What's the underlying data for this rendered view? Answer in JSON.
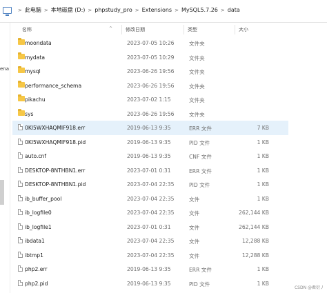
{
  "breadcrumb": [
    "此电脑",
    "本地磁盘 (D:)",
    "phpstudy_pro",
    "Extensions",
    "MySQL5.7.26",
    "data"
  ],
  "sidebar": {
    "partial_label": "ena"
  },
  "columns": {
    "name": "名称",
    "date": "修改日期",
    "type": "类型",
    "size": "大小"
  },
  "files": [
    {
      "name": "moondata",
      "date": "2023-07-05 10:26",
      "type": "文件夹",
      "size": "",
      "kind": "folder"
    },
    {
      "name": "mydata",
      "date": "2023-07-05 10:29",
      "type": "文件夹",
      "size": "",
      "kind": "folder"
    },
    {
      "name": "mysql",
      "date": "2023-06-26 19:56",
      "type": "文件夹",
      "size": "",
      "kind": "folder"
    },
    {
      "name": "performance_schema",
      "date": "2023-06-26 19:56",
      "type": "文件夹",
      "size": "",
      "kind": "folder"
    },
    {
      "name": "pikachu",
      "date": "2023-07-02 1:15",
      "type": "文件夹",
      "size": "",
      "kind": "folder"
    },
    {
      "name": "sys",
      "date": "2023-06-26 19:56",
      "type": "文件夹",
      "size": "",
      "kind": "folder"
    },
    {
      "name": "0KI5WXHAQMIF918.err",
      "date": "2019-06-13 9:35",
      "type": "ERR 文件",
      "size": "7 KB",
      "kind": "file",
      "selected": true
    },
    {
      "name": "0KI5WXHAQMIF918.pid",
      "date": "2019-06-13 9:35",
      "type": "PID 文件",
      "size": "1 KB",
      "kind": "file"
    },
    {
      "name": "auto.cnf",
      "date": "2019-06-13 9:35",
      "type": "CNF 文件",
      "size": "1 KB",
      "kind": "file"
    },
    {
      "name": "DESKTOP-8NTHBN1.err",
      "date": "2023-07-01 0:31",
      "type": "ERR 文件",
      "size": "1 KB",
      "kind": "file"
    },
    {
      "name": "DESKTOP-8NTHBN1.pid",
      "date": "2023-07-04 22:35",
      "type": "PID 文件",
      "size": "1 KB",
      "kind": "file"
    },
    {
      "name": "ib_buffer_pool",
      "date": "2023-07-04 22:35",
      "type": "文件",
      "size": "1 KB",
      "kind": "file"
    },
    {
      "name": "ib_logfile0",
      "date": "2023-07-04 22:35",
      "type": "文件",
      "size": "262,144 KB",
      "kind": "file"
    },
    {
      "name": "ib_logfile1",
      "date": "2023-07-01 0:31",
      "type": "文件",
      "size": "262,144 KB",
      "kind": "file"
    },
    {
      "name": "ibdata1",
      "date": "2023-07-04 22:35",
      "type": "文件",
      "size": "12,288 KB",
      "kind": "file"
    },
    {
      "name": "ibtmp1",
      "date": "2023-07-04 22:35",
      "type": "文件",
      "size": "12,288 KB",
      "kind": "file"
    },
    {
      "name": "php2.err",
      "date": "2019-06-13 9:35",
      "type": "ERR 文件",
      "size": "1 KB",
      "kind": "file"
    },
    {
      "name": "php2.pid",
      "date": "2019-06-13 9:35",
      "type": "PID 文件",
      "size": "1 KB",
      "kind": "file"
    }
  ],
  "watermark": "CSDN @君衍丿",
  "colors": {
    "folder": "#f6c746",
    "selected_row": "#e5f1fb"
  }
}
